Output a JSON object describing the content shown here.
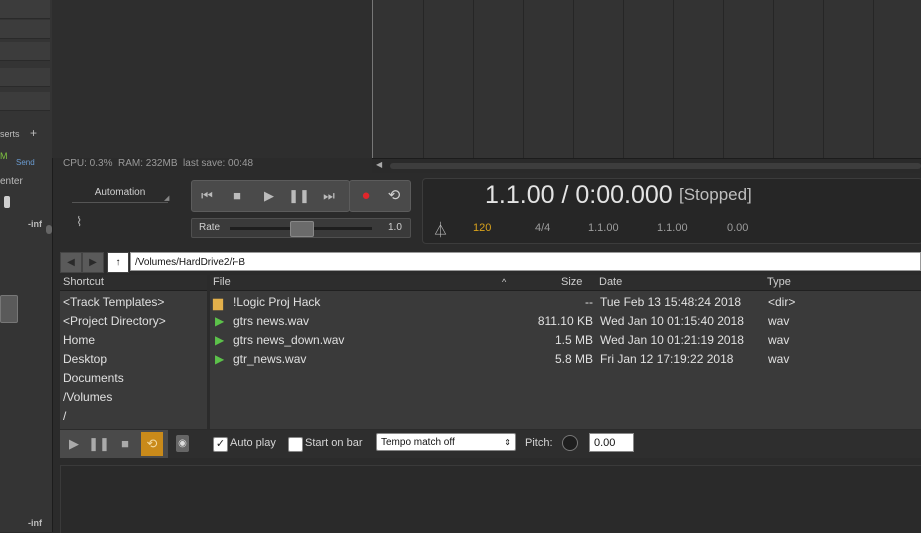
{
  "mixer": {
    "inserts_label": "serts",
    "add_glyph": "+",
    "m_label": "M",
    "send_label": "Send",
    "center_label": "enter",
    "inf_top": "-inf",
    "inf_bottom": "-inf"
  },
  "status": {
    "text": "CPU: 0.3%  RAM: 232MB  last save: 00:48"
  },
  "automation": {
    "label": "Automation"
  },
  "transport": {
    "icons": [
      "skip-back-icon",
      "stop-icon",
      "play-icon",
      "pause-icon",
      "skip-forward-icon",
      "record-icon",
      "loop-icon"
    ],
    "rate_label": "Rate",
    "rate_value": "1.0"
  },
  "time": {
    "main": "1.1.00 / 0:00.000",
    "state": "[Stopped]",
    "tempo": "120",
    "signature": "4/4",
    "sel_start": "1.1.00",
    "sel_end": "1.1.00",
    "sel_len": "0.00",
    "tempo_color": "#d9a21b"
  },
  "browser": {
    "path": "/Volumes/HardDrive2/FB",
    "up_glyph": "↑",
    "shortcuts_header": "Shortcut",
    "shortcuts": [
      "<Track Templates>",
      "<Project Directory>",
      "Home",
      "Desktop",
      "Documents",
      "/Volumes",
      "/"
    ],
    "columns": {
      "file": "File",
      "sort_glyph": "^",
      "size": "Size",
      "date": "Date",
      "type": "Type"
    },
    "files": [
      {
        "name": "!Logic Proj Hack",
        "size": "--",
        "date": "Tue Feb 13 15:48:24 2018",
        "type": "<dir>",
        "icon": "folder-icon"
      },
      {
        "name": "gtrs news.wav",
        "size": "811.10 KB",
        "date": "Wed Jan 10 01:15:40 2018",
        "type": "wav",
        "icon": "audio-file-icon"
      },
      {
        "name": "gtrs news_down.wav",
        "size": "1.5 MB",
        "date": "Wed Jan 10 01:21:19 2018",
        "type": "wav",
        "icon": "audio-file-icon"
      },
      {
        "name": "gtr_news.wav",
        "size": "5.8 MB",
        "date": "Fri Jan 12 17:19:22 2018",
        "type": "wav",
        "icon": "audio-file-icon"
      }
    ]
  },
  "preview": {
    "auto_play_label": "Auto play",
    "auto_play_checked": true,
    "start_on_bar_label": "Start on bar",
    "start_on_bar_checked": false,
    "tempo_match": "Tempo match off",
    "pitch_label": "Pitch:",
    "pitch_value": "0.00",
    "loop_color": "#c98a1a"
  }
}
